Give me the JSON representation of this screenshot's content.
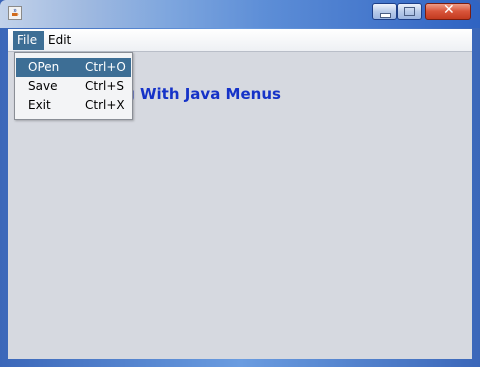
{
  "window": {
    "title": "",
    "icon": "java-cup-icon",
    "controls": [
      "minimize-icon",
      "maximize-icon",
      "close-icon"
    ]
  },
  "menubar": {
    "items": [
      {
        "label": "File",
        "active": true
      },
      {
        "label": "Edit",
        "active": false
      }
    ]
  },
  "file_menu": {
    "items": [
      {
        "label": "OPen",
        "accelerator": "Ctrl+O",
        "selected": true
      },
      {
        "label": "Save",
        "accelerator": "Ctrl+S",
        "selected": false
      },
      {
        "label": "Exit",
        "accelerator": "Ctrl+X",
        "selected": false
      }
    ]
  },
  "content": {
    "heading_visible_text": "g With Java Menus",
    "heading_color": "#1633c8"
  },
  "colors": {
    "selection": "#3d6e95",
    "client_background": "#d6d9e0"
  }
}
